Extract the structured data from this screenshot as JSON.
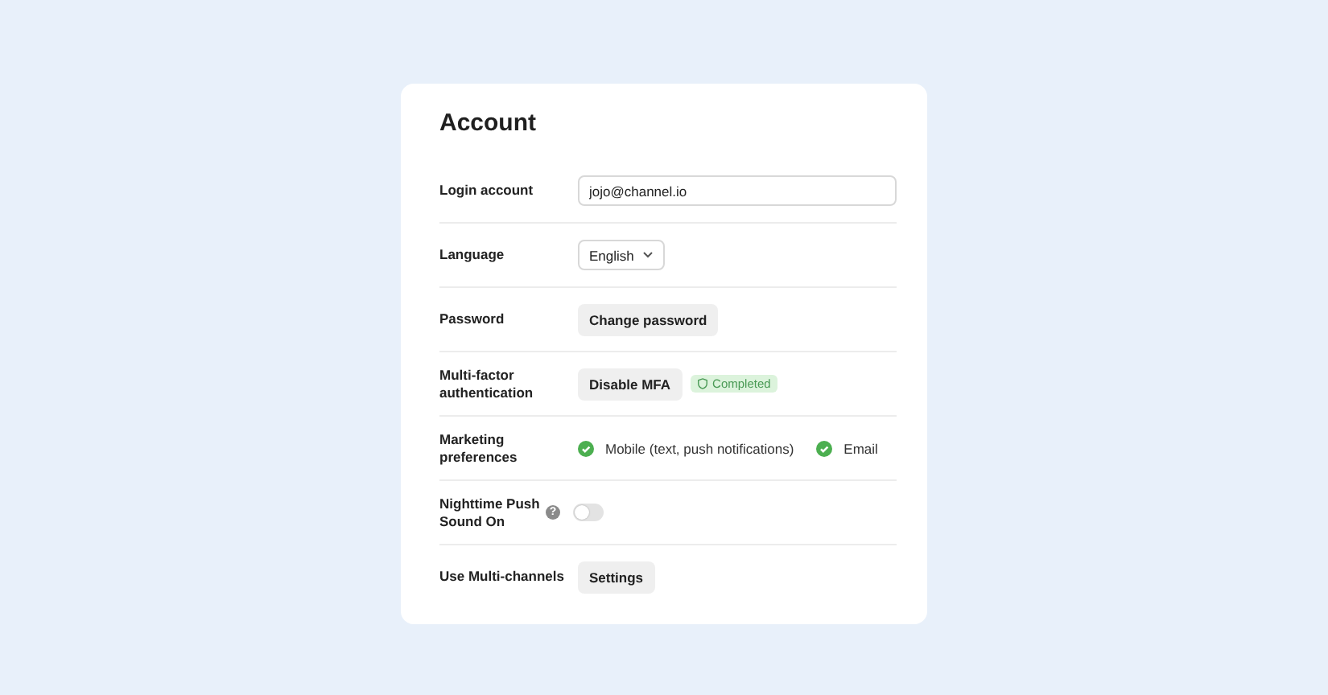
{
  "title": "Account",
  "rows": [
    {
      "kind": "field",
      "label": "Login account",
      "value": "jojo@channel.io"
    },
    {
      "kind": "dropdown",
      "label": "Language",
      "value": "English"
    },
    {
      "kind": "button",
      "label": "Password",
      "button": "Change password"
    },
    {
      "kind": "button",
      "label": "Multi-factor authentication",
      "button": "Disable MFA",
      "badge": "Completed"
    },
    {
      "kind": "checks",
      "label": "Marketing preferences",
      "options": [
        {
          "label": "Mobile (text, push notifications)",
          "checked": true
        },
        {
          "label": "Email",
          "checked": true
        }
      ]
    },
    {
      "kind": "toggle",
      "label": "Nighttime Push Sound On",
      "help": "?",
      "on": false
    },
    {
      "kind": "button",
      "label": "Use Multi-channels",
      "button": "Settings"
    }
  ]
}
